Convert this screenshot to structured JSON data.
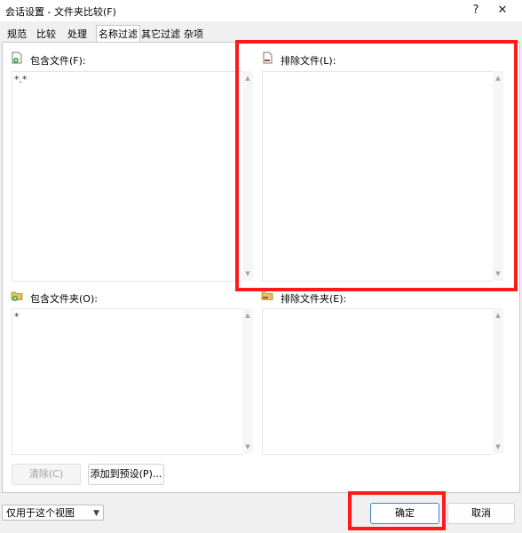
{
  "window": {
    "title": "会话设置 - 文件夹比较(F)",
    "help_label": "?",
    "close_label": "✕"
  },
  "tabs": [
    {
      "label": "规范"
    },
    {
      "label": "比较"
    },
    {
      "label": "处理"
    },
    {
      "label": "名称过滤"
    },
    {
      "label": "其它过滤"
    },
    {
      "label": "杂项"
    }
  ],
  "active_tab": "名称过滤",
  "include_files": {
    "label": "包含文件(F):",
    "value": "*.*"
  },
  "exclude_files": {
    "label": "排除文件(L):",
    "value": ""
  },
  "include_folders": {
    "label": "包含文件夹(O):",
    "value": "*"
  },
  "exclude_folders": {
    "label": "排除文件夹(E):",
    "value": ""
  },
  "buttons": {
    "clear": "清除(C)",
    "add_preset": "添加到预设(P)...",
    "ok": "确定",
    "cancel": "取消"
  },
  "scope_select": {
    "selected": "仅用于这个视图"
  },
  "colors": {
    "highlight": "#ff1a1a"
  }
}
